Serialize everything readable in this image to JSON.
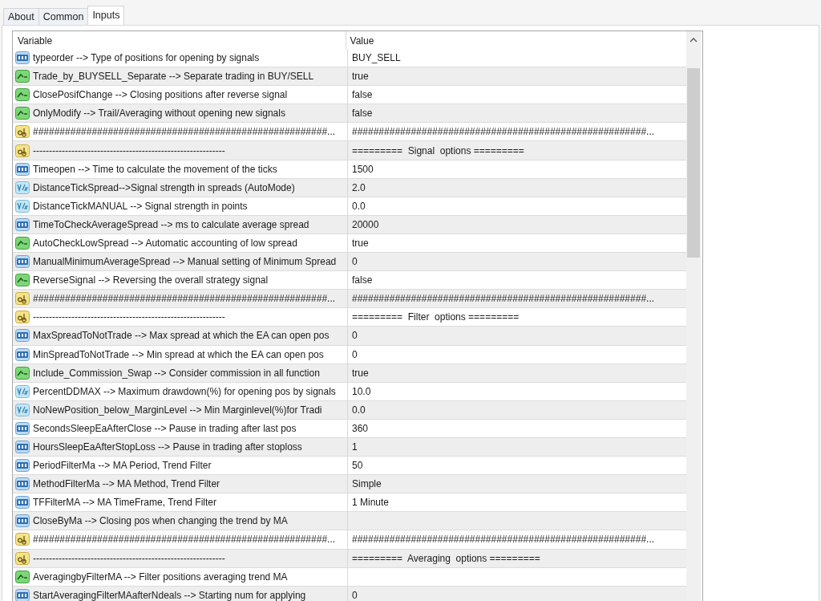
{
  "tabs": [
    {
      "label": "About",
      "selected": false
    },
    {
      "label": "Common",
      "selected": false
    },
    {
      "label": "Inputs",
      "selected": true
    }
  ],
  "table": {
    "columns": [
      "Variable",
      "Value"
    ],
    "rows": [
      {
        "kind": "int",
        "variable": "typeorder --> Type of positions for opening by signals",
        "value": "BUY_SELL"
      },
      {
        "kind": "bool",
        "variable": "Trade_by_BUYSELL_Separate --> Separate trading in BUY/SELL",
        "value": "true"
      },
      {
        "kind": "bool",
        "variable": "ClosePosifChange --> Closing positions after reverse signal",
        "value": "false"
      },
      {
        "kind": "bool",
        "variable": "OnlyModify --> Trail/Averaging without opening new signals",
        "value": "false"
      },
      {
        "kind": "string",
        "variable": "#######################################################...",
        "value": "#######################################################..."
      },
      {
        "kind": "string",
        "variable": "------------------------------------------------------------",
        "value": "=========  Signal  options ========="
      },
      {
        "kind": "int",
        "variable": "Timeopen --> Time to calculate the movement of the ticks",
        "value": "1500"
      },
      {
        "kind": "double",
        "variable": "DistanceTickSpread-->Signal strength in spreads (AutoMode)",
        "value": "2.0"
      },
      {
        "kind": "double",
        "variable": "DistanceTickMANUAL --> Signal strength in points",
        "value": "0.0"
      },
      {
        "kind": "int",
        "variable": "TimeToCheckAverageSpread --> ms to calculate average spread",
        "value": "20000"
      },
      {
        "kind": "bool",
        "variable": "AutoCheckLowSpread --> Automatic accounting of low spread",
        "value": "true"
      },
      {
        "kind": "int",
        "variable": "ManualMinimumAverageSpread --> Manual setting of Minimum Spread",
        "value": "0"
      },
      {
        "kind": "bool",
        "variable": "ReverseSignal --> Reversing the overall strategy signal",
        "value": "false"
      },
      {
        "kind": "string",
        "variable": "#######################################################...",
        "value": "#######################################################..."
      },
      {
        "kind": "string",
        "variable": "------------------------------------------------------------",
        "value": "=========  Filter  options ========="
      },
      {
        "kind": "int",
        "variable": "MaxSpreadToNotTrade --> Max spread at which the EA can open pos",
        "value": "0"
      },
      {
        "kind": "int",
        "variable": "MinSpreadToNotTrade --> Min spread at which the EA can open pos",
        "value": "0"
      },
      {
        "kind": "bool",
        "variable": "Include_Commission_Swap --> Consider commission in all function",
        "value": "true"
      },
      {
        "kind": "double",
        "variable": "PercentDDMAX --> Maximum drawdown(%) for opening pos by signals",
        "value": "10.0"
      },
      {
        "kind": "double",
        "variable": "NoNewPosition_below_MarginLevel --> Min Marginlevel(%)for Tradi",
        "value": "0.0"
      },
      {
        "kind": "int",
        "variable": "SecondsSleepEaAfterClose --> Pause in trading after last pos",
        "value": "360"
      },
      {
        "kind": "int",
        "variable": "HoursSleepEaAfterStopLoss --> Pause in trading after stoploss",
        "value": "1"
      },
      {
        "kind": "int",
        "variable": "PeriodFilterMa --> MA Period, Trend Filter",
        "value": "50"
      },
      {
        "kind": "int",
        "variable": "MethodFilterMa --> MA Method, Trend Filter",
        "value": "Simple"
      },
      {
        "kind": "int",
        "variable": "TFFilterMA --> MA TimeFrame, Trend Filter",
        "value": "1 Minute"
      },
      {
        "kind": "int",
        "variable": "CloseByMa --> Closing pos when changing the trend by MA"
      },
      {
        "kind": "string",
        "variable": "#######################################################...",
        "value": "#######################################################..."
      },
      {
        "kind": "string",
        "variable": "------------------------------------------------------------",
        "value": "=========  Averaging  options ========="
      },
      {
        "kind": "bool",
        "variable": "AveragingbyFilterMA --> Filter positions averaging trend MA"
      },
      {
        "kind": "int",
        "variable": "StartAveragingFilterMAafterNdeals --> Starting num for applying",
        "value": "0"
      }
    ]
  }
}
